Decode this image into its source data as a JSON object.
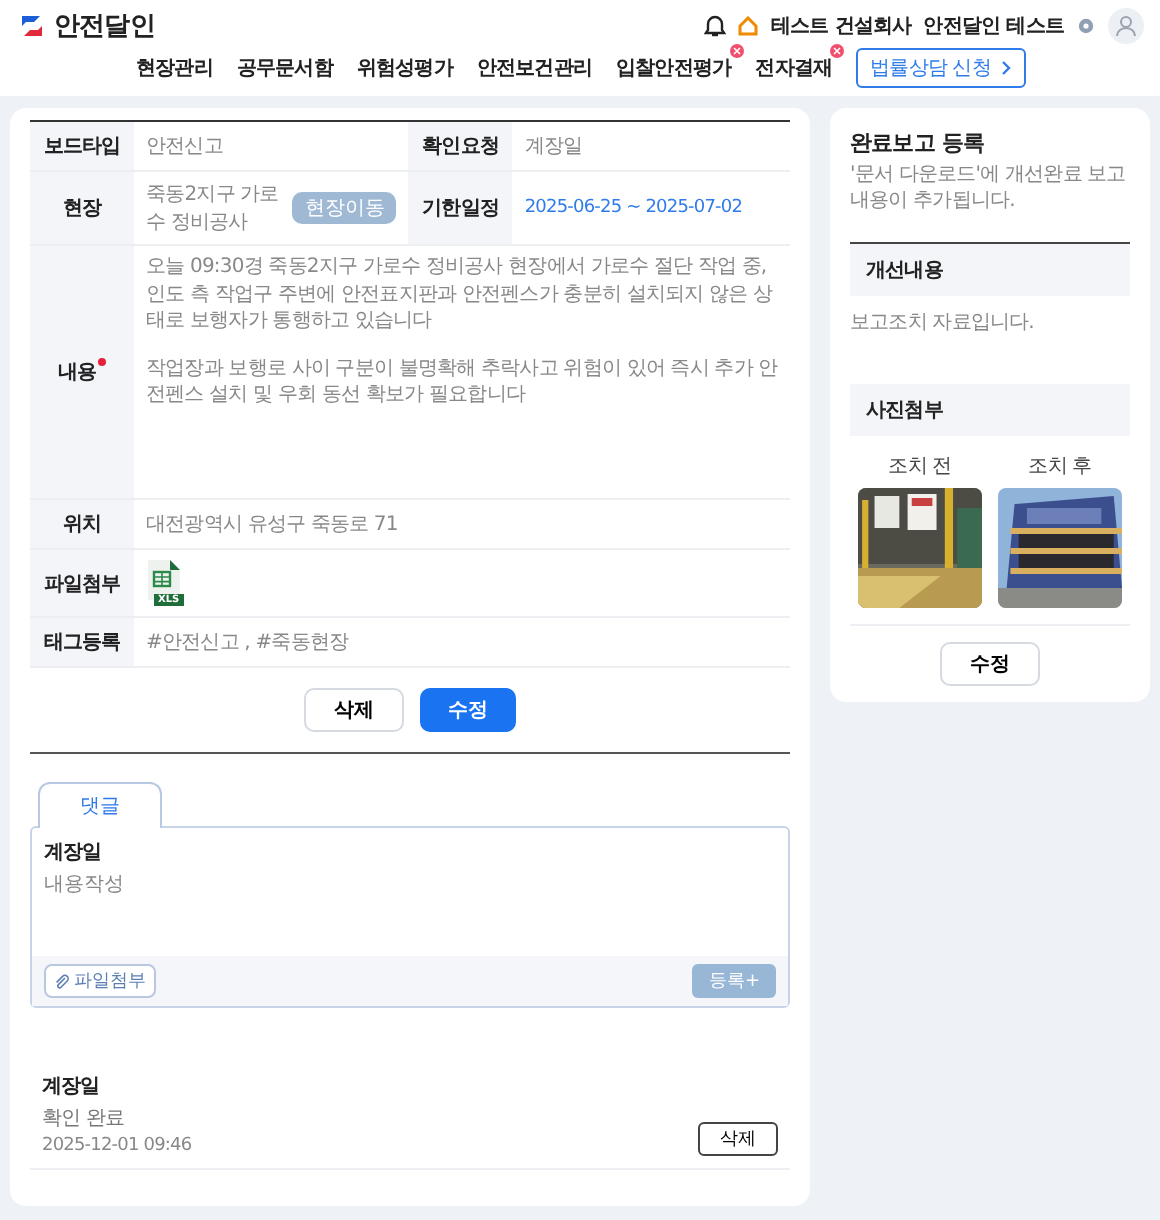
{
  "header": {
    "logo": "안전달인",
    "nav": [
      {
        "label": "현장관리",
        "badge": false
      },
      {
        "label": "공무문서함",
        "badge": false
      },
      {
        "label": "위험성평가",
        "badge": false
      },
      {
        "label": "안전보건관리",
        "badge": false
      },
      {
        "label": "입찰안전평가",
        "badge": true
      },
      {
        "label": "전자결재",
        "badge": true
      }
    ],
    "consult_button": "법률상담 신청",
    "company": "테스트 건설회사",
    "user": "안전달인 테스트"
  },
  "report": {
    "board_type": {
      "label": "보드타입",
      "value": "안전신고"
    },
    "confirm_request": {
      "label": "확인요청",
      "value": "계장일"
    },
    "site": {
      "label": "현장",
      "value": "죽동2지구 가로수 정비공사",
      "button": "현장이동"
    },
    "deadline": {
      "label": "기한일정",
      "value": "2025-06-25 ~ 2025-07-02"
    },
    "content": {
      "label": "내용",
      "required": true,
      "paragraphs": [
        "오늘 09:30경 죽동2지구 가로수 정비공사 현장에서 가로수 절단 작업 중,\n인도 측 작업구 주변에 안전표지판과 안전펜스가 충분히 설치되지 않은 상태로 보행자가 통행하고 있습니다",
        "작업장과 보행로 사이 구분이 불명확해 추락사고 위험이 있어 즉시 추가 안전펜스 설치 및 우회 동선 확보가 필요합니다"
      ]
    },
    "location": {
      "label": "위치",
      "value": "대전광역시 유성구 죽동로 71"
    },
    "files": {
      "label": "파일첨부",
      "items": [
        {
          "type": "XLS"
        }
      ]
    },
    "tags": {
      "label": "태그등록",
      "value": "#안전신고 , #죽동현장"
    },
    "delete_button": "삭제",
    "edit_button": "수정"
  },
  "comments": {
    "tabs": [
      {
        "label": "댓글",
        "selected": true
      }
    ],
    "editor": {
      "author": "계장일",
      "placeholder": "내용작성",
      "attach_button": "파일첨부",
      "submit_button": "등록+",
      "submit_disabled": true
    },
    "items": [
      {
        "author": "계장일",
        "text": "확인 완료",
        "time": "2025-12-01 09:46",
        "delete_button": "삭제"
      }
    ]
  },
  "completion": {
    "title": "완료보고 등록",
    "subtitle": "'문서 다운로드'에 개선완료 보고 내용이 추가됩니다.",
    "improvement_label": "개선내용",
    "improvement_text": "보고조치 자료입니다.",
    "photos_label": "사진첨부",
    "photos": [
      {
        "caption": "조치 전",
        "kind": "picture"
      },
      {
        "caption": "조치 후",
        "kind": "picture"
      }
    ],
    "edit_button": "수정"
  }
}
